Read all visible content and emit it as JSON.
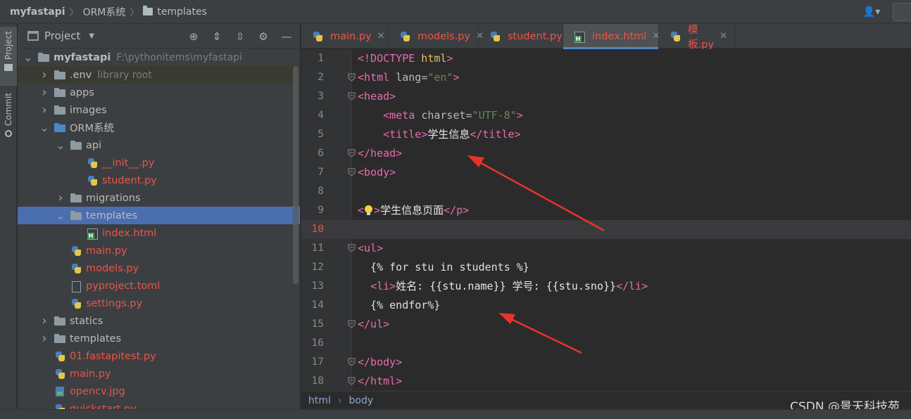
{
  "breadcrumb": {
    "project": "myfastapi",
    "folder": "ORM系统",
    "current": "templates"
  },
  "toolstrip": {
    "project_label": "Project",
    "commit_label": "Commit"
  },
  "project_panel": {
    "title": "Project",
    "tree": [
      {
        "name": "myfastapi",
        "path": "F:\\pythonitems\\myfastapi",
        "indent": 0,
        "expanded": true,
        "icon": "folder-icon"
      },
      {
        "name": ".env",
        "path": "library root",
        "indent": 1,
        "expanded": false,
        "icon": "folder-icon"
      },
      {
        "name": "apps",
        "indent": 1,
        "expanded": false,
        "icon": "folder-icon"
      },
      {
        "name": "images",
        "indent": 1,
        "expanded": false,
        "icon": "folder-icon"
      },
      {
        "name": "ORM系统",
        "indent": 1,
        "expanded": true,
        "icon": "folder-icon"
      },
      {
        "name": "api",
        "indent": 2,
        "expanded": true,
        "icon": "package-folder-icon"
      },
      {
        "name": "__init__.py",
        "indent": 3,
        "icon": "python-file-icon"
      },
      {
        "name": "student.py",
        "indent": 3,
        "icon": "python-file-icon"
      },
      {
        "name": "migrations",
        "indent": 2,
        "expanded": false,
        "icon": "folder-icon"
      },
      {
        "name": "templates",
        "indent": 2,
        "expanded": true,
        "icon": "folder-icon"
      },
      {
        "name": "index.html",
        "indent": 3,
        "icon": "html-file-icon"
      },
      {
        "name": "main.py",
        "indent": 2,
        "icon": "python-file-icon"
      },
      {
        "name": "models.py",
        "indent": 2,
        "icon": "python-file-icon"
      },
      {
        "name": "pyproject.toml",
        "indent": 2,
        "icon": "toml-file-icon"
      },
      {
        "name": "settings.py",
        "indent": 2,
        "icon": "python-file-icon"
      },
      {
        "name": "statics",
        "indent": 1,
        "expanded": false,
        "icon": "folder-icon"
      },
      {
        "name": "templates",
        "indent": 1,
        "expanded": false,
        "icon": "folder-icon"
      },
      {
        "name": "01.fastapitest.py",
        "indent": 1,
        "icon": "python-file-icon"
      },
      {
        "name": "main.py",
        "indent": 1,
        "icon": "python-file-icon"
      },
      {
        "name": "opencv.jpg",
        "indent": 1,
        "icon": "image-file-icon"
      },
      {
        "name": "quickstart.py",
        "indent": 1,
        "icon": "python-file-icon"
      }
    ]
  },
  "tabs": [
    {
      "label": "main.py",
      "icon": "python-file-icon",
      "active": false
    },
    {
      "label": "models.py",
      "icon": "python-file-icon",
      "active": false
    },
    {
      "label": "student.py",
      "icon": "python-file-icon",
      "active": false
    },
    {
      "label": "index.html",
      "icon": "html-file-icon",
      "active": true
    },
    {
      "label": "模板.py",
      "icon": "python-file-icon",
      "active": false
    }
  ],
  "editor": {
    "current_line": 10,
    "lines": [
      "<!DOCTYPE html>",
      "<html lang=\"en\">",
      "<head>",
      "    <meta charset=\"UTF-8\">",
      "    <title>学生信息</title>",
      "</head>",
      "<body>",
      "",
      "<p>学生信息页面</p>",
      "",
      "<ul>",
      "  {% for stu in students %}",
      "  <li>姓名: {{stu.name}} 学号: {{stu.sno}}</li>",
      "  {% endfor%}",
      "</ul>",
      "",
      "</body>",
      "</html>"
    ]
  },
  "editor_breadcrumb": [
    "html",
    "body"
  ],
  "watermark": "CSDN @景天科技苑",
  "colors": {
    "annotation_arrow": "#e8332a",
    "modified_file": "#e9544b",
    "selection": "#4b6eaf"
  }
}
